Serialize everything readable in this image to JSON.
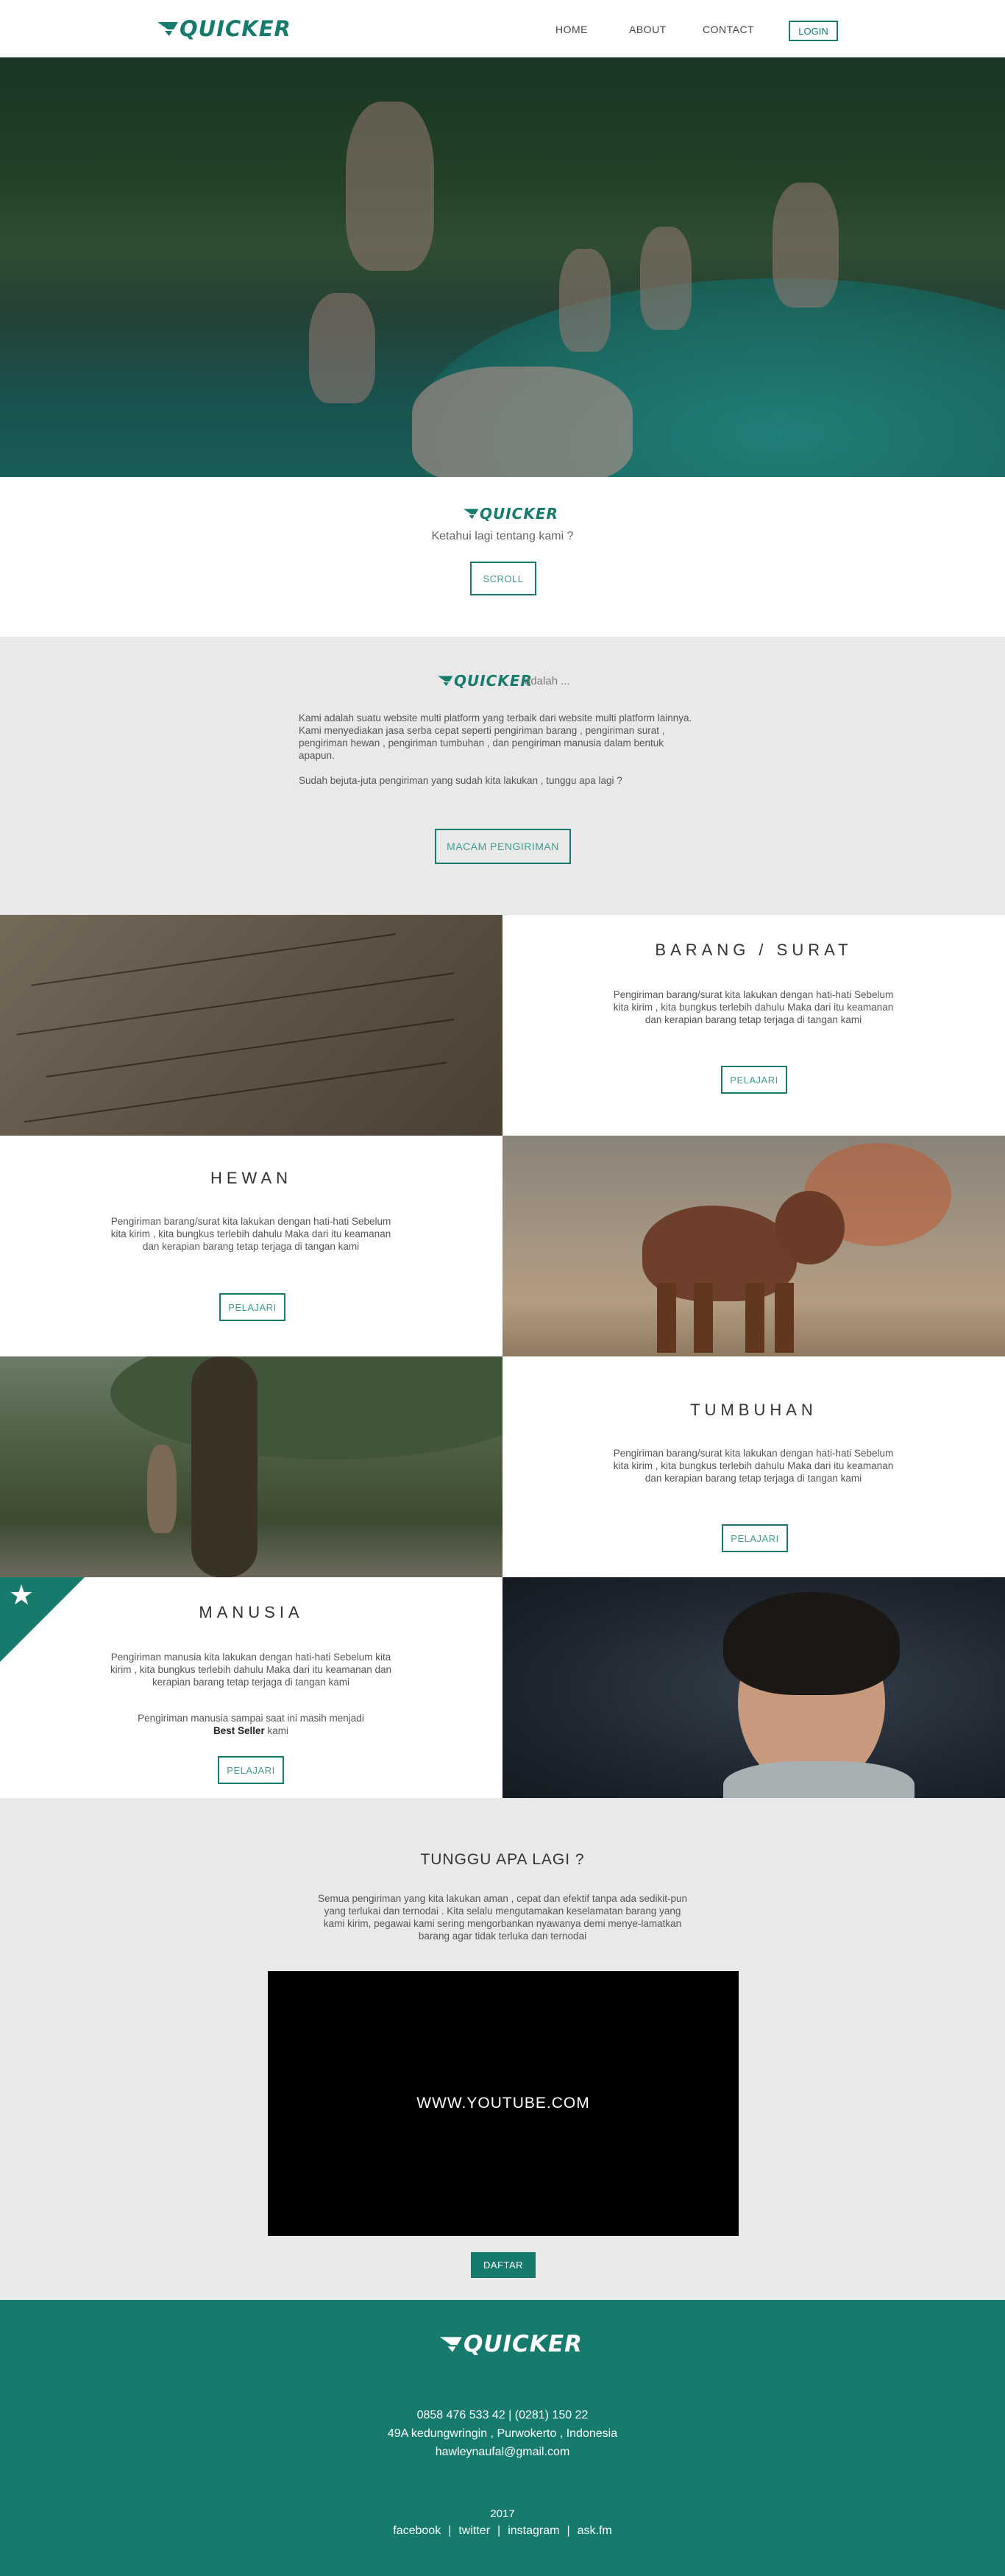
{
  "brand": {
    "name": "QUICKER",
    "accent": "#167a6c"
  },
  "nav": {
    "links": [
      "HOME",
      "ABOUT",
      "CONTACT"
    ],
    "login": "LOGIN"
  },
  "intro": {
    "subtitle": "Ketahui lagi tentang kami ?",
    "scroll": "SCROLL"
  },
  "about": {
    "suffix": "adalah ...",
    "p1": "Kami adalah suatu website multi platform yang terbaik dari website multi platform lainnya. Kami menyediakan jasa serba cepat seperti pengiriman barang , pengiriman surat , pengiriman hewan , pengiriman tumbuhan , dan pengiriman manusia dalam bentuk apapun.",
    "p2": "Sudah bejuta-juta pengiriman yang sudah kita lakukan , tunggu apa lagi  ?",
    "button": "MACAM PENGIRIMAN"
  },
  "services": {
    "barang": {
      "title": "BARANG / SURAT",
      "text": "Pengiriman barang/surat kita lakukan dengan hati-hati Sebelum kita kirim , kita bungkus terlebih dahulu Maka dari itu keamanan dan kerapian barang tetap terjaga di tangan kami",
      "button": "PELAJARI"
    },
    "hewan": {
      "title": "HEWAN",
      "text": "Pengiriman barang/surat kita lakukan dengan hati-hati Sebelum kita kirim , kita bungkus terlebih dahulu Maka dari itu keamanan dan kerapian barang tetap terjaga di tangan kami",
      "button": "PELAJARI"
    },
    "tumbuhan": {
      "title": "TUMBUHAN",
      "text": "Pengiriman barang/surat kita lakukan dengan hati-hati Sebelum kita kirim , kita bungkus terlebih dahulu Maka dari itu keamanan dan kerapian barang tetap terjaga di tangan kami",
      "button": "PELAJARI"
    },
    "manusia": {
      "title": "MANUSIA",
      "text": "Pengiriman manusia kita lakukan dengan hati-hati Sebelum kita kirim , kita bungkus terlebih dahulu Maka dari itu keamanan dan kerapian barang tetap terjaga di tangan kami",
      "text2": "Pengiriman manusia sampai saat ini masih menjadi",
      "best": "Best Seller",
      "kami": "kami",
      "button": "PELAJARI",
      "ribbon_icon": "star-icon"
    }
  },
  "cta": {
    "title": "TUNGGU APA LAGI ?",
    "text": "Semua pengiriman yang kita lakukan aman , cepat dan efektif tanpa ada sedikit-pun yang terlukai dan ternodai . Kita selalu mengutamakan keselamatan barang yang kami kirim, pegawai kami sering mengorbankan nyawanya demi menye-lamatkan barang agar tidak terluka dan ternodai",
    "video": "WWW.YOUTUBE.COM",
    "button": "DAFTAR"
  },
  "footer": {
    "phone": "0858 476 533 42  |  (0281) 150 22",
    "address": "49A kedungwringin , Purwokerto , Indonesia",
    "email": "hawleynaufal@gmail.com",
    "year": "2017",
    "social": [
      "facebook",
      "twitter",
      "instagram",
      "ask.fm"
    ],
    "separator": "|"
  }
}
